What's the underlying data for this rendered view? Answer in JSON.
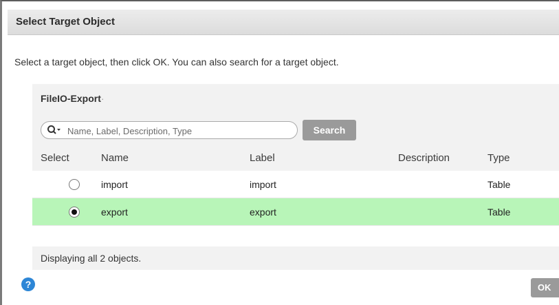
{
  "dialog": {
    "title": "Select Target Object",
    "instructions": "Select a target object, then click OK. You can also search for a target object."
  },
  "panel": {
    "folder": "FileIO-Export",
    "folder_suffix": "·",
    "search": {
      "placeholder": "Name, Label, Description, Type",
      "button_label": "Search",
      "icon": "search-icon"
    },
    "table": {
      "columns": [
        "Select",
        "Name",
        "Label",
        "Description",
        "Type"
      ],
      "rows": [
        {
          "selected": false,
          "name": "import",
          "label": "import",
          "description": "",
          "type": "Table"
        },
        {
          "selected": true,
          "name": "export",
          "label": "export",
          "description": "",
          "type": "Table"
        }
      ],
      "selected_row_color": "#b8f5b8"
    },
    "footer": "Displaying all 2 objects."
  },
  "help": {
    "icon": "help-icon",
    "glyph": "?"
  },
  "actions": {
    "ok_label": "OK"
  }
}
